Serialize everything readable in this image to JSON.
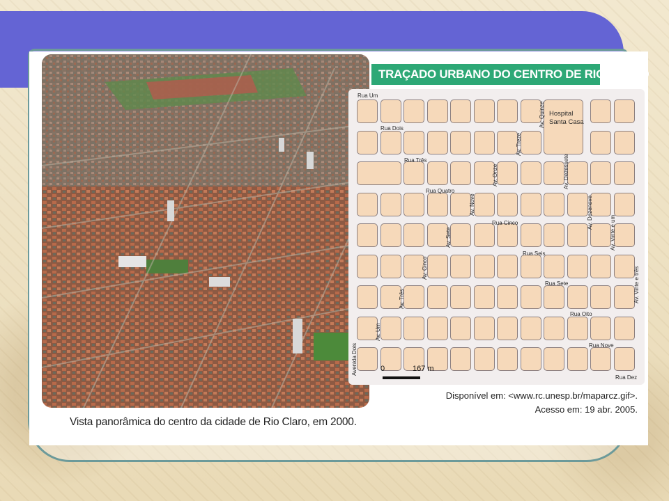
{
  "colors": {
    "banner": "#6464d4",
    "title_box": "#2da876",
    "block_fill": "#f6d9ba",
    "block_border": "#8c7f7f"
  },
  "caption": "Vista panorâmica do centro da cidade de Rio Claro, em 2000.",
  "map": {
    "title": "TRAÇADO URBANO DO CENTRO DE RIO CLARO",
    "hospital": [
      "Hospital",
      "Santa Casa"
    ],
    "horizontal_streets": [
      "Rua Um",
      "Rua Dois",
      "Rua Três",
      "Rua Quatro",
      "Rua Cinco",
      "Rua Seis",
      "Rua Sete",
      "Rua Oito",
      "Rua Nove",
      "Rua Dez"
    ],
    "vertical_streets": [
      "Avenida Dois",
      "Av. Um",
      "Av. Três",
      "Av. Cinco",
      "Av. Sete",
      "Av. Nove",
      "Av. Onze",
      "Av. Treze",
      "Av. Quinze",
      "Av. Dezessete",
      "Av. Dezenove",
      "Av. Vinte e um",
      "Av. Vinte e três"
    ],
    "scale": {
      "start": "0",
      "end": "167 m"
    }
  },
  "source": {
    "line1": "Disponível em: <www.rc.unesp.br/maparcz.gif>.",
    "line2": "Acesso em: 19 abr. 2005."
  }
}
